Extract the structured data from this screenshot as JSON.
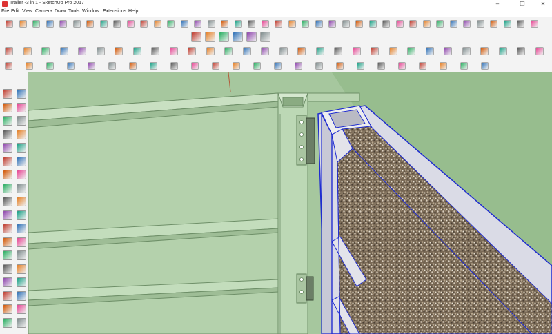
{
  "window": {
    "title": "Trailer -3 in 1 - SketchUp Pro 2017",
    "controls": {
      "minimize": "–",
      "maximize": "❐",
      "close": "✕"
    }
  },
  "menu": {
    "items": [
      "File",
      "Edit",
      "View",
      "Camera",
      "Draw",
      "Tools",
      "Window",
      "Extensions",
      "Help"
    ]
  },
  "toolbars": {
    "row1_icons": [
      "follow-me-icon",
      "arc-icon",
      "2pt-arc-icon",
      "3pt-arc-icon",
      "pie-icon",
      "rounded-corner-icon",
      "fillet-icon",
      "chamfer-icon",
      "offset-icon",
      "curve-icon",
      "bezier-icon",
      "spline-icon",
      "polyline-icon",
      "loft-icon",
      "sweep-icon",
      "extrude-icon",
      "shell-icon",
      "joint-push-pull-icon",
      "vector-push-pull-icon",
      "normal-push-pull-icon",
      "solid-union-icon",
      "solid-subtract-icon",
      "solid-trim-icon",
      "solid-split-icon",
      "round-corner-icon",
      "bevel-icon",
      "subdivide-icon",
      "smooth-icon",
      "weld-icon",
      "edge-tools-icon",
      "clean-up-icon",
      "quad-face-icon",
      "curvy-loft-icon",
      "flowify-icon",
      "sketch-icon",
      "tape-icon",
      "dimension-icon",
      "text-icon",
      "axes-icon",
      "more-icon"
    ],
    "row2_icons": [
      "view-iso-icon",
      "view-top-icon",
      "view-front-icon",
      "view-right-icon",
      "view-back-icon",
      "view-left-icon"
    ],
    "row3_icons": [
      "gear-tool-icon",
      "pencil-tool-icon",
      "dim-tool-icon",
      "line-tool-icon",
      "circle-tool-icon",
      "polygon-tool-icon",
      "arc-tool-icon",
      "offset-tool-icon",
      "follow-icon",
      "move-tool-icon",
      "rotate-tool-icon",
      "scale-tool-icon",
      "paint-tool-icon",
      "red-sphere-icon",
      "blue-sphere-icon",
      "cube-icon",
      "cube-alt-icon",
      "move-alt-icon",
      "rotate-alt-icon",
      "scale-alt-icon",
      "flip-icon",
      "component-icon",
      "group-icon",
      "explode-icon",
      "layer-icon",
      "coin-icon",
      "wrench-icon",
      "sphere-a-icon",
      "sphere-b-icon",
      "sphere-c-icon"
    ],
    "row4_icons": [
      "arrow-red-icon",
      "arrow-green-icon",
      "arrow-blue-icon",
      "arrow-multi-icon",
      "drop-icon",
      "green-box-icon",
      "axis-icon",
      "align-icon",
      "extend-icon",
      "trim-icon",
      "stretch-icon",
      "split-icon",
      "mirror-icon",
      "array-icon",
      "copy-icon",
      "zip-icon",
      "rotate3d-icon",
      "rotate3d-b-icon",
      "square-icon",
      "scale-red-icon",
      "sphere-blue-icon",
      "flag-icon",
      "tag-icon",
      "close-red-icon"
    ]
  },
  "left_tools": [
    "select-icon",
    "eraser-cube-icon",
    "paint-bucket-icon",
    "eraser-icon",
    "pencil-icon",
    "freehand-icon",
    "rectangle-icon",
    "rotated-rect-icon",
    "circle-icon",
    "polygon-icon",
    "arc-icon",
    "pie-icon",
    "two-point-arc-icon",
    "three-point-arc-icon",
    "move-icon",
    "push-pull-icon",
    "rotate-icon",
    "follow-me-icon",
    "scale-icon",
    "offset-icon",
    "tape-icon",
    "dimension-icon",
    "protractor-icon",
    "text-icon",
    "axes-icon",
    "3d-text-icon",
    "orbit-icon",
    "pan-icon",
    "zoom-icon",
    "zoom-window-icon",
    "zoom-extents-icon",
    "previous-icon",
    "walk-icon",
    "look-around-icon",
    "position-camera-icon",
    "section-icon"
  ]
}
